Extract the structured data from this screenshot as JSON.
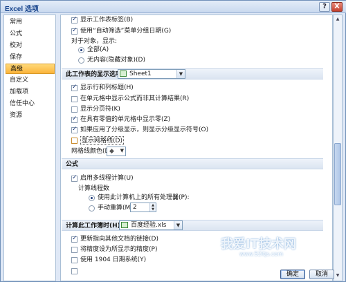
{
  "window": {
    "title": "Excel 选项",
    "help_label": "?",
    "close_label": "X"
  },
  "nav": {
    "items": [
      {
        "label": "常用"
      },
      {
        "label": "公式"
      },
      {
        "label": "校对"
      },
      {
        "label": "保存"
      },
      {
        "label": "高级",
        "active": true
      },
      {
        "label": "自定义"
      },
      {
        "label": "加载项"
      },
      {
        "label": "信任中心"
      },
      {
        "label": "资源"
      }
    ]
  },
  "top": {
    "show_sheet_tabs": "显示工作表标签(B)",
    "group_dates": "使用“自动筛选”菜单分组日期(G)",
    "objects_label": "对于对象，显示:",
    "radio_all": "全部(A)",
    "radio_none": "无内容(隐藏对象)(D)"
  },
  "worksheet": {
    "header": "此工作表的显示选项(S):",
    "selected_sheet": "Sheet1",
    "show_headers": "显示行和列标题(H)",
    "show_formulas": "在单元格中显示公式而非其计算结果(R)",
    "show_page_breaks": "显示分页符(K)",
    "show_zero": "在具有零值的单元格中显示零(Z)",
    "show_outline": "如果应用了分级显示，则显示分级显示符号(O)",
    "show_gridlines": "显示网格线(D)",
    "gridline_color_label": "网格线颜色(D)"
  },
  "formulas": {
    "header": "公式",
    "multithread": "启用多线程计算(U)",
    "threads_label": "计算线程数",
    "use_all_processors": "使用此计算机上的所有处理器(P):",
    "processor_count": "2",
    "manual": "手动重算(M)",
    "manual_value": "2"
  },
  "workbook": {
    "header": "计算此工作簿时(H):",
    "selected_workbook": "百度经验.xls",
    "update_links": "更新指向其他文档的链接(D)",
    "precision": "将精度设为所显示的精度(P)",
    "date_1904": "使用 1904 日期系统(Y)"
  },
  "buttons": {
    "ok": "确定",
    "cancel": "取消"
  },
  "watermark": {
    "text": "我爱IT技术网",
    "sub": "www.52itjs.com"
  }
}
